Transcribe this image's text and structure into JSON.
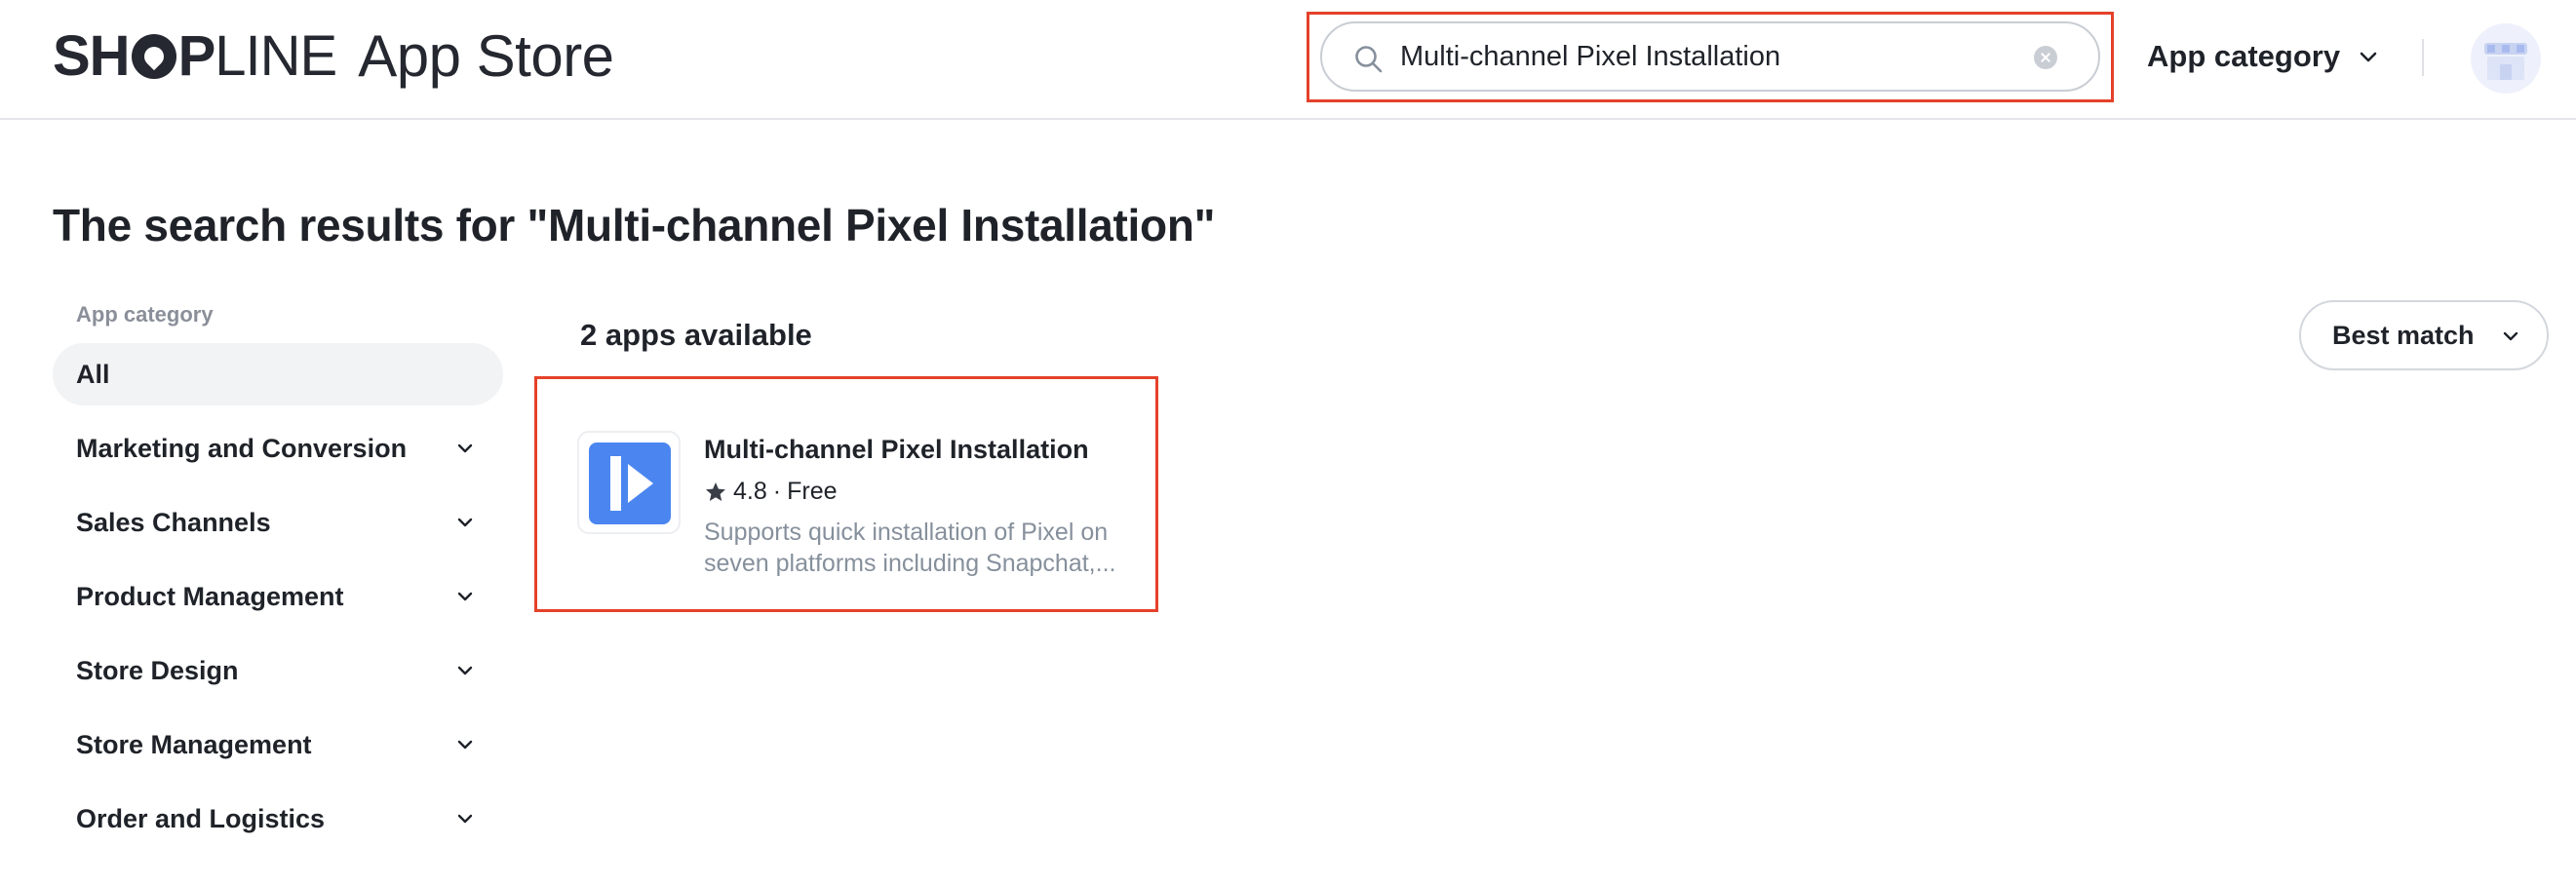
{
  "header": {
    "logo_text": "SHOPLINE",
    "logo_app_text": "App Store",
    "search": {
      "value": "Multi-channel Pixel Installation",
      "placeholder": ""
    },
    "app_category_label": "App category"
  },
  "page_title": "The search results for \"Multi-channel Pixel Installation\"",
  "sidebar": {
    "heading": "App category",
    "items": [
      {
        "label": "All",
        "active": true
      },
      {
        "label": "Marketing and Conversion"
      },
      {
        "label": "Sales Channels"
      },
      {
        "label": "Product Management"
      },
      {
        "label": "Store Design"
      },
      {
        "label": "Store Management"
      },
      {
        "label": "Order and Logistics"
      }
    ]
  },
  "results": {
    "count_label": "2 apps available",
    "sort_label": "Best match",
    "apps": [
      {
        "name": "Multi-channel Pixel Installation",
        "rating": "4.8",
        "separator": "·",
        "price": "Free",
        "description": "Supports quick installation of Pixel on seven platforms including Snapchat,...",
        "icon": "play-flag-icon"
      }
    ]
  },
  "colors": {
    "highlight": "#e5412a",
    "app_icon_bg": "#4b86f0",
    "text_primary": "#1f2329",
    "text_secondary": "#86909c",
    "active_bg": "#f2f3f5"
  }
}
